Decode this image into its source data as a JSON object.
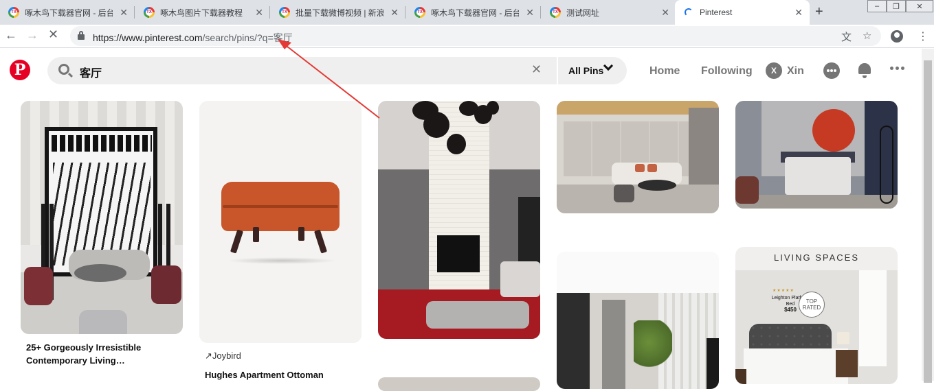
{
  "browser": {
    "tabs": [
      {
        "title": "啄木鸟下载器官网 - 后台"
      },
      {
        "title": "啄木鸟图片下载器教程"
      },
      {
        "title": "批量下载微博视频 | 新浪"
      },
      {
        "title": "啄木鸟下载器官网 - 后台"
      },
      {
        "title": "测试网址"
      },
      {
        "title": "Pinterest"
      }
    ],
    "favicon_text": "TX",
    "new_tab_label": "+",
    "close_label": "✕",
    "url_host": "https://www.pinterest.com",
    "url_path": "/search/pins/?q=客厅"
  },
  "header": {
    "logo": "P",
    "search_query": "客厅",
    "clear_label": "✕",
    "filter_label": "All Pins",
    "nav": {
      "home": "Home",
      "following": "Following"
    },
    "user_initial": "X",
    "user_name": "Xin"
  },
  "pins": [
    {
      "title": "25+ Gorgeously Irresistible Contemporary Living…"
    },
    {
      "source": "Joybird",
      "title": "Hughes Apartment Ottoman"
    },
    {
      "ad": {
        "brand": "LIVING SPACES",
        "product": "Leighton Platform Bed",
        "price": "$450",
        "badge": "TOP RATED",
        "stars": "★★★★★"
      }
    }
  ],
  "colors": {
    "pinterest_red": "#e60023",
    "annotation_arrow": "#e53935"
  }
}
